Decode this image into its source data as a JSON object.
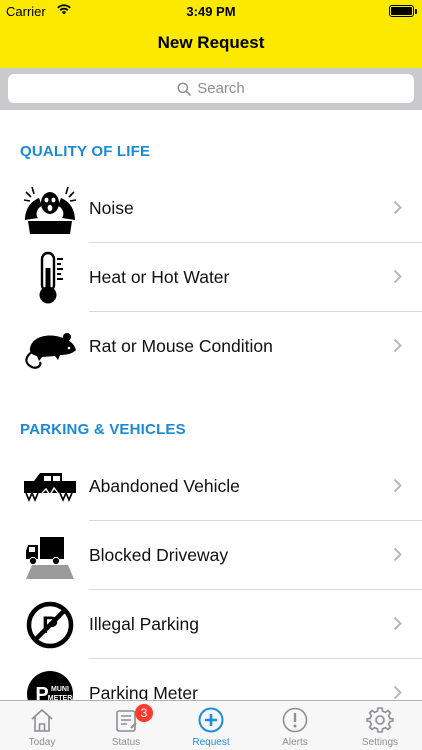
{
  "status_bar": {
    "carrier": "Carrier",
    "time": "3:49 PM"
  },
  "nav": {
    "title": "New Request"
  },
  "search": {
    "placeholder": "Search"
  },
  "sections": [
    {
      "title": "QUALITY OF LIFE",
      "items": [
        {
          "label": "Noise",
          "icon": "noise-icon"
        },
        {
          "label": "Heat or Hot Water",
          "icon": "thermometer-icon"
        },
        {
          "label": "Rat or Mouse Condition",
          "icon": "rat-icon"
        }
      ]
    },
    {
      "title": "PARKING & VEHICLES",
      "items": [
        {
          "label": "Abandoned Vehicle",
          "icon": "abandoned-vehicle-icon"
        },
        {
          "label": "Blocked Driveway",
          "icon": "blocked-driveway-icon"
        },
        {
          "label": "Illegal Parking",
          "icon": "no-parking-icon"
        },
        {
          "label": "Parking Meter",
          "icon": "parking-meter-icon",
          "icon_text": "MUNI METER"
        }
      ]
    }
  ],
  "tabs": [
    {
      "label": "Today",
      "icon": "home-icon"
    },
    {
      "label": "Status",
      "icon": "clipboard-icon",
      "badge": "3"
    },
    {
      "label": "Request",
      "icon": "add-circle-icon",
      "active": true
    },
    {
      "label": "Alerts",
      "icon": "alert-icon"
    },
    {
      "label": "Settings",
      "icon": "gear-icon"
    }
  ],
  "colors": {
    "nav_bar": "#fbe900",
    "section_header": "#1a8ad6",
    "active_tab": "#1b8ee0",
    "badge": "#ff3b30"
  }
}
